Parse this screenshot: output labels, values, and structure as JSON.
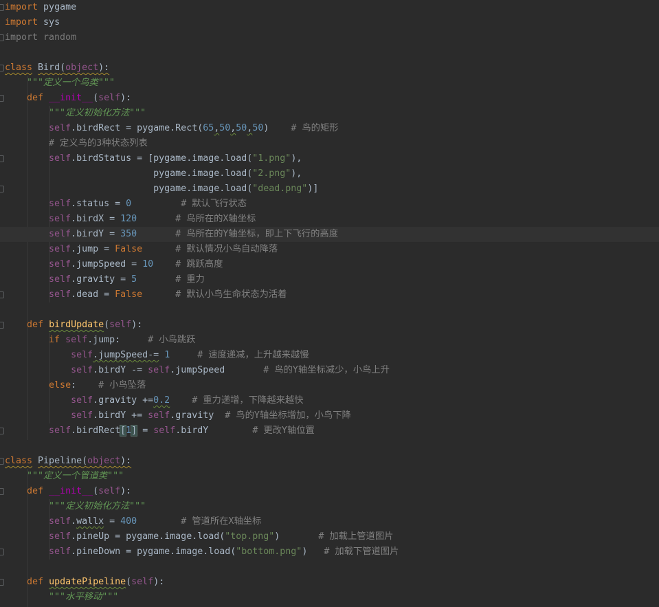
{
  "editor": {
    "language": "Python",
    "colors": {
      "background": "#2b2b2b",
      "keyword": "#cc7832",
      "self": "#94558d",
      "number": "#6897bb",
      "string": "#6a8759",
      "docstring": "#629755",
      "comment": "#808080",
      "function": "#ffc66d",
      "magic_method": "#b200b2",
      "plain": "#a9b7c6"
    },
    "lines": [
      {
        "tokens": [
          [
            "kw",
            "import"
          ],
          [
            "plain",
            " pygame"
          ]
        ]
      },
      {
        "tokens": [
          [
            "kw",
            "import"
          ],
          [
            "plain",
            " sys"
          ]
        ]
      },
      {
        "tokens": [
          [
            "unused",
            "import random"
          ]
        ]
      },
      {
        "tokens": []
      },
      {
        "tokens": [
          [
            "kw warn",
            "class"
          ],
          [
            "plain",
            " "
          ],
          [
            "plain warn",
            "Bird"
          ],
          [
            "plain warn",
            "("
          ],
          [
            "self warn",
            "object"
          ],
          [
            "plain warn",
            "):"
          ]
        ]
      },
      {
        "tokens": [
          [
            "plain",
            "    "
          ],
          [
            "doc",
            "\"\"\"定义一个鸟类\"\"\""
          ]
        ]
      },
      {
        "tokens": [
          [
            "plain",
            "    "
          ],
          [
            "kw",
            "def"
          ],
          [
            "plain",
            " "
          ],
          [
            "magic",
            "__init__"
          ],
          [
            "plain",
            "("
          ],
          [
            "self",
            "self"
          ],
          [
            "plain",
            "):"
          ]
        ]
      },
      {
        "tokens": [
          [
            "plain",
            "        "
          ],
          [
            "doc",
            "\"\"\"定义初始化方法\"\"\""
          ]
        ]
      },
      {
        "tokens": [
          [
            "plain",
            "        "
          ],
          [
            "self",
            "self"
          ],
          [
            "plain",
            ".birdRect = pygame.Rect("
          ],
          [
            "num",
            "65"
          ],
          [
            "plain typo",
            ","
          ],
          [
            "num",
            "50"
          ],
          [
            "plain typo",
            ","
          ],
          [
            "num",
            "50"
          ],
          [
            "plain typo",
            ","
          ],
          [
            "num",
            "50"
          ],
          [
            "plain",
            ")    "
          ],
          [
            "cmt",
            "# 鸟的矩形"
          ]
        ]
      },
      {
        "tokens": [
          [
            "plain",
            "        "
          ],
          [
            "cmt",
            "# 定义鸟的3种状态列表"
          ]
        ]
      },
      {
        "tokens": [
          [
            "plain",
            "        "
          ],
          [
            "self",
            "self"
          ],
          [
            "plain",
            ".birdStatus = [pygame.image.load("
          ],
          [
            "str",
            "\"1.png\""
          ],
          [
            "plain",
            "),"
          ]
        ]
      },
      {
        "tokens": [
          [
            "plain",
            "                           pygame.image.load("
          ],
          [
            "str",
            "\"2.png\""
          ],
          [
            "plain",
            "),"
          ]
        ]
      },
      {
        "tokens": [
          [
            "plain",
            "                           pygame.image.load("
          ],
          [
            "str",
            "\"dead.png\""
          ],
          [
            "plain",
            ")]"
          ]
        ]
      },
      {
        "tokens": [
          [
            "plain",
            "        "
          ],
          [
            "self",
            "self"
          ],
          [
            "plain",
            ".status = "
          ],
          [
            "num",
            "0"
          ],
          [
            "plain",
            "         "
          ],
          [
            "cmt",
            "# 默认飞行状态"
          ]
        ]
      },
      {
        "tokens": [
          [
            "plain",
            "        "
          ],
          [
            "self",
            "self"
          ],
          [
            "plain",
            ".birdX = "
          ],
          [
            "num",
            "120"
          ],
          [
            "plain",
            "       "
          ],
          [
            "cmt",
            "# 鸟所在的X轴坐标"
          ]
        ]
      },
      {
        "tokens": [
          [
            "plain",
            "        "
          ],
          [
            "self",
            "self"
          ],
          [
            "plain",
            ".birdY = "
          ],
          [
            "num",
            "350"
          ],
          [
            "plain",
            "       "
          ],
          [
            "cmt",
            "# 鸟所在的Y轴坐标，即上下飞行的高度"
          ]
        ],
        "current": true
      },
      {
        "tokens": [
          [
            "plain",
            "        "
          ],
          [
            "self",
            "self"
          ],
          [
            "plain",
            ".jump = "
          ],
          [
            "kw",
            "False"
          ],
          [
            "plain",
            "      "
          ],
          [
            "cmt",
            "# 默认情况小鸟自动降落"
          ]
        ]
      },
      {
        "tokens": [
          [
            "plain",
            "        "
          ],
          [
            "self",
            "self"
          ],
          [
            "plain",
            ".jumpSpeed = "
          ],
          [
            "num",
            "10"
          ],
          [
            "plain",
            "    "
          ],
          [
            "cmt",
            "# 跳跃高度"
          ]
        ]
      },
      {
        "tokens": [
          [
            "plain",
            "        "
          ],
          [
            "self",
            "self"
          ],
          [
            "plain",
            ".gravity = "
          ],
          [
            "num",
            "5"
          ],
          [
            "plain",
            "       "
          ],
          [
            "cmt",
            "# 重力"
          ]
        ]
      },
      {
        "tokens": [
          [
            "plain",
            "        "
          ],
          [
            "self",
            "self"
          ],
          [
            "plain",
            ".dead = "
          ],
          [
            "kw",
            "False"
          ],
          [
            "plain",
            "      "
          ],
          [
            "cmt",
            "# 默认小鸟生命状态为活着"
          ]
        ]
      },
      {
        "tokens": []
      },
      {
        "tokens": [
          [
            "plain",
            "    "
          ],
          [
            "kw",
            "def"
          ],
          [
            "plain",
            " "
          ],
          [
            "fn typo",
            "birdUpdate"
          ],
          [
            "plain",
            "("
          ],
          [
            "self",
            "self"
          ],
          [
            "plain",
            "):"
          ]
        ]
      },
      {
        "tokens": [
          [
            "plain",
            "        "
          ],
          [
            "kw",
            "if"
          ],
          [
            "plain",
            " "
          ],
          [
            "self",
            "self"
          ],
          [
            "plain",
            ".jump:     "
          ],
          [
            "cmt",
            "# 小鸟跳跃"
          ]
        ]
      },
      {
        "tokens": [
          [
            "plain",
            "            "
          ],
          [
            "self",
            "self"
          ],
          [
            "plain typo",
            ".jumpSpeed-="
          ],
          [
            "plain",
            " "
          ],
          [
            "num",
            "1"
          ],
          [
            "plain",
            "     "
          ],
          [
            "cmt",
            "# 速度递减，上升越来越慢"
          ]
        ]
      },
      {
        "tokens": [
          [
            "plain",
            "            "
          ],
          [
            "self",
            "self"
          ],
          [
            "plain",
            ".birdY -= "
          ],
          [
            "self",
            "self"
          ],
          [
            "plain",
            ".jumpSpeed       "
          ],
          [
            "cmt",
            "# 鸟的Y轴坐标减少，小鸟上升"
          ]
        ]
      },
      {
        "tokens": [
          [
            "plain",
            "        "
          ],
          [
            "kw",
            "else"
          ],
          [
            "plain",
            ":    "
          ],
          [
            "cmt",
            "# 小鸟坠落"
          ]
        ]
      },
      {
        "tokens": [
          [
            "plain",
            "            "
          ],
          [
            "self",
            "self"
          ],
          [
            "plain",
            ".gravity +="
          ],
          [
            "num typo",
            "0.2"
          ],
          [
            "plain",
            "    "
          ],
          [
            "cmt",
            "# 重力递增，下降越来越快"
          ]
        ]
      },
      {
        "tokens": [
          [
            "plain",
            "            "
          ],
          [
            "self",
            "self"
          ],
          [
            "plain",
            ".birdY += "
          ],
          [
            "self",
            "self"
          ],
          [
            "plain",
            ".gravity  "
          ],
          [
            "cmt",
            "# 鸟的Y轴坐标增加，小鸟下降"
          ]
        ]
      },
      {
        "tokens": [
          [
            "plain",
            "        "
          ],
          [
            "self",
            "self"
          ],
          [
            "plain",
            ".birdRect"
          ],
          [
            "plain bracket-hl",
            "["
          ],
          [
            "num",
            "1"
          ],
          [
            "plain bracket-hl",
            "]"
          ],
          [
            "plain",
            " = "
          ],
          [
            "self",
            "self"
          ],
          [
            "plain",
            ".birdY        "
          ],
          [
            "cmt",
            "# 更改Y轴位置"
          ]
        ]
      },
      {
        "tokens": []
      },
      {
        "tokens": [
          [
            "kw warn",
            "class"
          ],
          [
            "plain",
            " "
          ],
          [
            "plain warn",
            "Pipeline"
          ],
          [
            "plain warn",
            "("
          ],
          [
            "self warn",
            "object"
          ],
          [
            "plain warn",
            "):"
          ]
        ]
      },
      {
        "tokens": [
          [
            "plain",
            "    "
          ],
          [
            "doc",
            "\"\"\"定义一个管道类\"\"\""
          ]
        ]
      },
      {
        "tokens": [
          [
            "plain",
            "    "
          ],
          [
            "kw",
            "def"
          ],
          [
            "plain",
            " "
          ],
          [
            "magic",
            "__init__"
          ],
          [
            "plain",
            "("
          ],
          [
            "self",
            "self"
          ],
          [
            "plain",
            "):"
          ]
        ]
      },
      {
        "tokens": [
          [
            "plain",
            "        "
          ],
          [
            "doc",
            "\"\"\"定义初始化方法\"\"\""
          ]
        ]
      },
      {
        "tokens": [
          [
            "plain",
            "        "
          ],
          [
            "self",
            "self"
          ],
          [
            "plain",
            "."
          ],
          [
            "plain typo",
            "wallx"
          ],
          [
            "plain",
            " = "
          ],
          [
            "num",
            "400"
          ],
          [
            "plain",
            "        "
          ],
          [
            "cmt",
            "# 管道所在X轴坐标"
          ]
        ]
      },
      {
        "tokens": [
          [
            "plain",
            "        "
          ],
          [
            "self",
            "self"
          ],
          [
            "plain",
            ".pineUp = pygame.image.load("
          ],
          [
            "str",
            "\"top.png\""
          ],
          [
            "plain",
            ")       "
          ],
          [
            "cmt",
            "# 加载上管道图片"
          ]
        ]
      },
      {
        "tokens": [
          [
            "plain",
            "        "
          ],
          [
            "self",
            "self"
          ],
          [
            "plain",
            ".pineDown = pygame.image.load("
          ],
          [
            "str",
            "\"bottom.png\""
          ],
          [
            "plain",
            ")   "
          ],
          [
            "cmt",
            "# 加载下管道图片"
          ]
        ]
      },
      {
        "tokens": []
      },
      {
        "tokens": [
          [
            "plain",
            "    "
          ],
          [
            "kw",
            "def"
          ],
          [
            "plain",
            " "
          ],
          [
            "fn typo",
            "updatePipeline"
          ],
          [
            "plain",
            "("
          ],
          [
            "self",
            "self"
          ],
          [
            "plain",
            "):"
          ]
        ]
      },
      {
        "tokens": [
          [
            "plain",
            "        "
          ],
          [
            "doc",
            "\"\"\"水平移动\"\"\""
          ]
        ]
      }
    ]
  }
}
